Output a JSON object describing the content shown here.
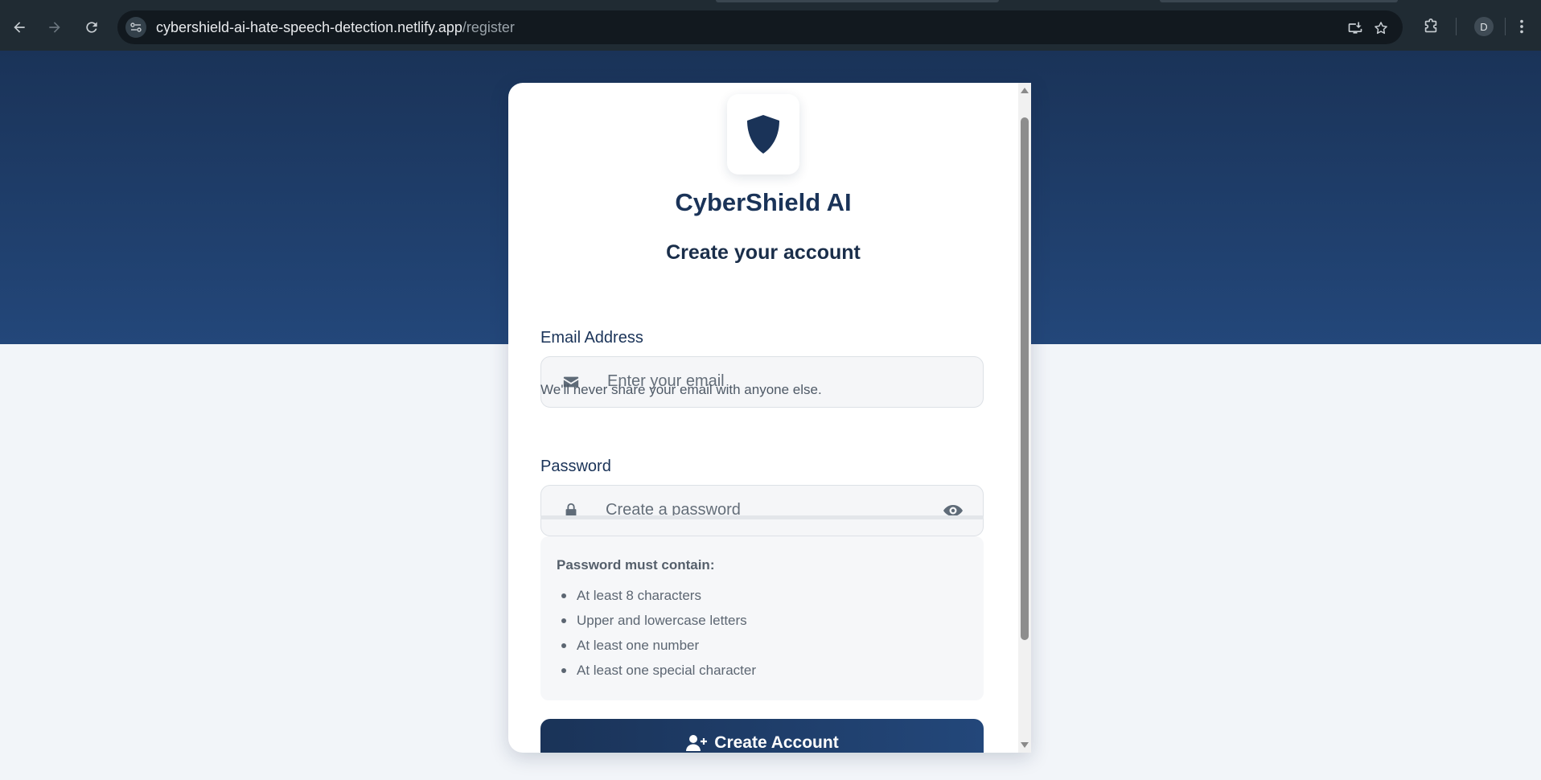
{
  "browser": {
    "url_host": "cybershield-ai-hate-speech-detection.netlify.app",
    "url_path": "/register",
    "profile_initial": "D"
  },
  "brand": {
    "name": "CyberShield AI",
    "logo_icon": "shield-icon"
  },
  "form": {
    "heading": "Create your account",
    "email": {
      "label": "Email Address",
      "placeholder": "Enter your email",
      "value": "",
      "helper": "We'll never share your email with anyone else.",
      "icon": "envelope-icon"
    },
    "password": {
      "label": "Password",
      "placeholder": "Create a password",
      "value": "",
      "icon": "lock-icon",
      "toggle_icon": "eye-icon",
      "strength": 0
    },
    "requirements": {
      "title": "Password must contain:",
      "items": [
        "At least 8 characters",
        "Upper and lowercase letters",
        "At least one number",
        "At least one special character"
      ]
    },
    "submit_label": "Create Account",
    "submit_icon": "user-plus-icon"
  },
  "colors": {
    "brand_navy": "#1a3358",
    "hero_gradient_end": "#23477a",
    "page_background": "#f2f5f9"
  }
}
